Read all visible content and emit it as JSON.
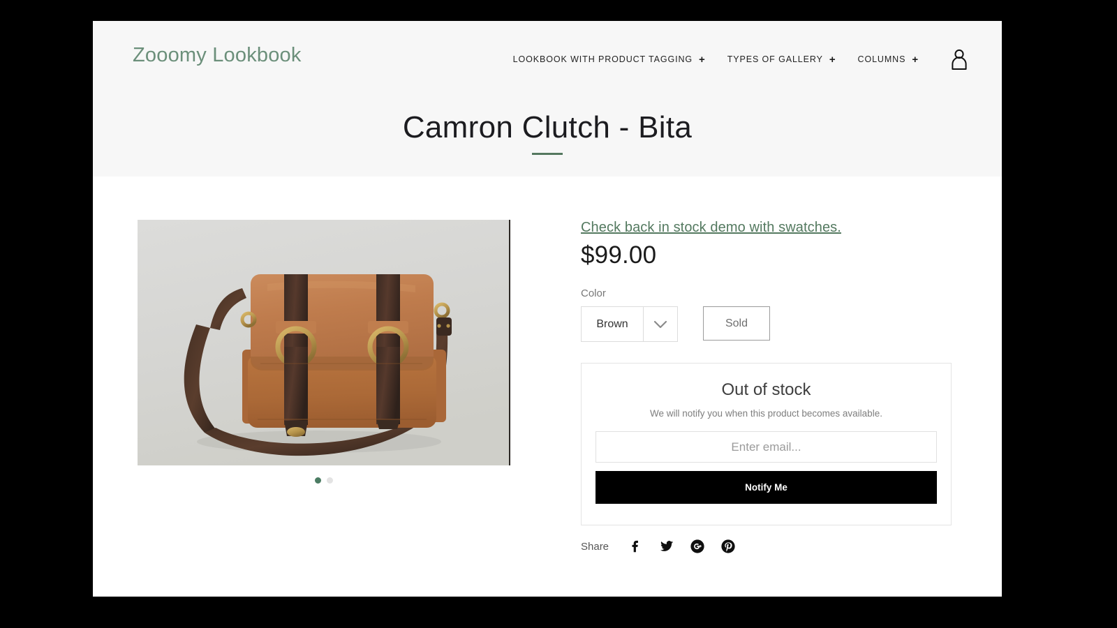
{
  "header": {
    "logo": "Zooomy Lookbook",
    "nav": [
      {
        "label": "LOOKBOOK WITH PRODUCT TAGGING",
        "plus": "+"
      },
      {
        "label": "TYPES OF GALLERY",
        "plus": "+"
      },
      {
        "label": "COLUMNS",
        "plus": "+"
      }
    ],
    "account_icon": "user-icon"
  },
  "page": {
    "title": "Camron Clutch - Bita"
  },
  "gallery": {
    "image_alt": "Camron Clutch - Bita tan leather messenger bag",
    "dots": [
      {
        "active": true
      },
      {
        "active": false
      }
    ]
  },
  "product": {
    "stock_link": "Check back in stock demo with swatches.",
    "price": "$99.00",
    "color_label": "Color",
    "color_value": "Brown",
    "color_options": [
      "Brown"
    ],
    "sold_label": "Sold",
    "chevron_icon": "chevron-down-icon"
  },
  "notify": {
    "title": "Out of stock",
    "subtitle": "We will notify you when this product becomes available.",
    "email_placeholder": "Enter email...",
    "email_value": "",
    "button_label": "Notify Me"
  },
  "share": {
    "label": "Share",
    "icons": [
      "facebook-icon",
      "twitter-icon",
      "google-plus-icon",
      "pinterest-icon"
    ]
  },
  "colors": {
    "brand_green": "#6b8f7a",
    "link_green": "#53795f",
    "divider_green": "#54785f",
    "dot_active": "#4b7c63",
    "header_bg": "#f7f7f7",
    "notify_button_bg": "#000000",
    "leather_tan": "#c07a4d",
    "leather_dark": "#3a2a22"
  }
}
